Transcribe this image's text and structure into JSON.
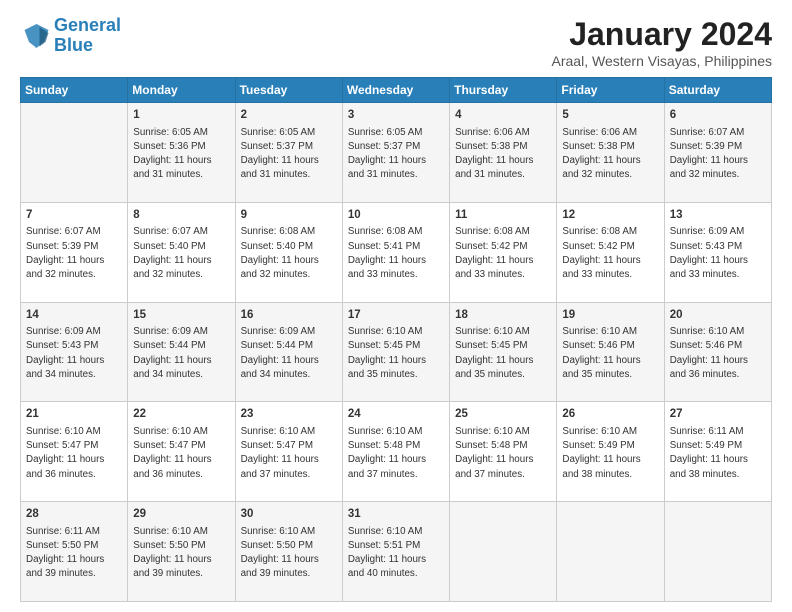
{
  "logo": {
    "line1": "General",
    "line2": "Blue"
  },
  "title": "January 2024",
  "subtitle": "Araal, Western Visayas, Philippines",
  "header_days": [
    "Sunday",
    "Monday",
    "Tuesday",
    "Wednesday",
    "Thursday",
    "Friday",
    "Saturday"
  ],
  "weeks": [
    [
      {
        "day": "",
        "info": ""
      },
      {
        "day": "1",
        "info": "Sunrise: 6:05 AM\nSunset: 5:36 PM\nDaylight: 11 hours\nand 31 minutes."
      },
      {
        "day": "2",
        "info": "Sunrise: 6:05 AM\nSunset: 5:37 PM\nDaylight: 11 hours\nand 31 minutes."
      },
      {
        "day": "3",
        "info": "Sunrise: 6:05 AM\nSunset: 5:37 PM\nDaylight: 11 hours\nand 31 minutes."
      },
      {
        "day": "4",
        "info": "Sunrise: 6:06 AM\nSunset: 5:38 PM\nDaylight: 11 hours\nand 31 minutes."
      },
      {
        "day": "5",
        "info": "Sunrise: 6:06 AM\nSunset: 5:38 PM\nDaylight: 11 hours\nand 32 minutes."
      },
      {
        "day": "6",
        "info": "Sunrise: 6:07 AM\nSunset: 5:39 PM\nDaylight: 11 hours\nand 32 minutes."
      }
    ],
    [
      {
        "day": "7",
        "info": "Sunrise: 6:07 AM\nSunset: 5:39 PM\nDaylight: 11 hours\nand 32 minutes."
      },
      {
        "day": "8",
        "info": "Sunrise: 6:07 AM\nSunset: 5:40 PM\nDaylight: 11 hours\nand 32 minutes."
      },
      {
        "day": "9",
        "info": "Sunrise: 6:08 AM\nSunset: 5:40 PM\nDaylight: 11 hours\nand 32 minutes."
      },
      {
        "day": "10",
        "info": "Sunrise: 6:08 AM\nSunset: 5:41 PM\nDaylight: 11 hours\nand 33 minutes."
      },
      {
        "day": "11",
        "info": "Sunrise: 6:08 AM\nSunset: 5:42 PM\nDaylight: 11 hours\nand 33 minutes."
      },
      {
        "day": "12",
        "info": "Sunrise: 6:08 AM\nSunset: 5:42 PM\nDaylight: 11 hours\nand 33 minutes."
      },
      {
        "day": "13",
        "info": "Sunrise: 6:09 AM\nSunset: 5:43 PM\nDaylight: 11 hours\nand 33 minutes."
      }
    ],
    [
      {
        "day": "14",
        "info": "Sunrise: 6:09 AM\nSunset: 5:43 PM\nDaylight: 11 hours\nand 34 minutes."
      },
      {
        "day": "15",
        "info": "Sunrise: 6:09 AM\nSunset: 5:44 PM\nDaylight: 11 hours\nand 34 minutes."
      },
      {
        "day": "16",
        "info": "Sunrise: 6:09 AM\nSunset: 5:44 PM\nDaylight: 11 hours\nand 34 minutes."
      },
      {
        "day": "17",
        "info": "Sunrise: 6:10 AM\nSunset: 5:45 PM\nDaylight: 11 hours\nand 35 minutes."
      },
      {
        "day": "18",
        "info": "Sunrise: 6:10 AM\nSunset: 5:45 PM\nDaylight: 11 hours\nand 35 minutes."
      },
      {
        "day": "19",
        "info": "Sunrise: 6:10 AM\nSunset: 5:46 PM\nDaylight: 11 hours\nand 35 minutes."
      },
      {
        "day": "20",
        "info": "Sunrise: 6:10 AM\nSunset: 5:46 PM\nDaylight: 11 hours\nand 36 minutes."
      }
    ],
    [
      {
        "day": "21",
        "info": "Sunrise: 6:10 AM\nSunset: 5:47 PM\nDaylight: 11 hours\nand 36 minutes."
      },
      {
        "day": "22",
        "info": "Sunrise: 6:10 AM\nSunset: 5:47 PM\nDaylight: 11 hours\nand 36 minutes."
      },
      {
        "day": "23",
        "info": "Sunrise: 6:10 AM\nSunset: 5:47 PM\nDaylight: 11 hours\nand 37 minutes."
      },
      {
        "day": "24",
        "info": "Sunrise: 6:10 AM\nSunset: 5:48 PM\nDaylight: 11 hours\nand 37 minutes."
      },
      {
        "day": "25",
        "info": "Sunrise: 6:10 AM\nSunset: 5:48 PM\nDaylight: 11 hours\nand 37 minutes."
      },
      {
        "day": "26",
        "info": "Sunrise: 6:10 AM\nSunset: 5:49 PM\nDaylight: 11 hours\nand 38 minutes."
      },
      {
        "day": "27",
        "info": "Sunrise: 6:11 AM\nSunset: 5:49 PM\nDaylight: 11 hours\nand 38 minutes."
      }
    ],
    [
      {
        "day": "28",
        "info": "Sunrise: 6:11 AM\nSunset: 5:50 PM\nDaylight: 11 hours\nand 39 minutes."
      },
      {
        "day": "29",
        "info": "Sunrise: 6:10 AM\nSunset: 5:50 PM\nDaylight: 11 hours\nand 39 minutes."
      },
      {
        "day": "30",
        "info": "Sunrise: 6:10 AM\nSunset: 5:50 PM\nDaylight: 11 hours\nand 39 minutes."
      },
      {
        "day": "31",
        "info": "Sunrise: 6:10 AM\nSunset: 5:51 PM\nDaylight: 11 hours\nand 40 minutes."
      },
      {
        "day": "",
        "info": ""
      },
      {
        "day": "",
        "info": ""
      },
      {
        "day": "",
        "info": ""
      }
    ]
  ]
}
